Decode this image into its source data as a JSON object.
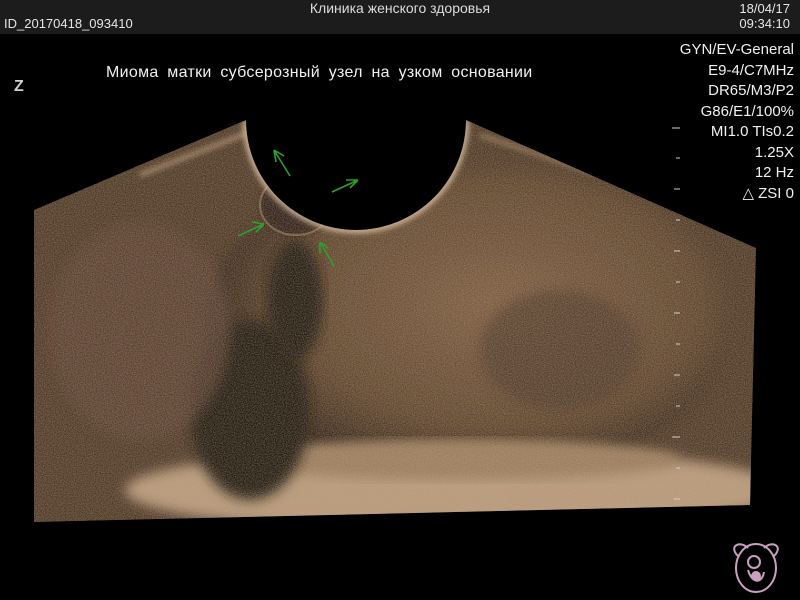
{
  "header": {
    "clinic": "Клиника женского здоровья",
    "scan_id": "ID_20170418_093410",
    "date": "18/04/17",
    "time": "09:34:10"
  },
  "caption": "Миома матки субсерозный узел на узком основании",
  "orientation_marker": "Z",
  "params": {
    "preset": "GYN/EV-General",
    "probe": "E9-4/C7MHz",
    "dr": "DR65/M3/P2",
    "gain": "G86/E1/100%",
    "mi_tis": "MI1.0 TIs0.2",
    "zoom": "1.25X",
    "frame_rate": "12 Hz",
    "zsi": "ZSI 0"
  },
  "colors": {
    "tissue": "#8a6a4a",
    "arrow": "#2ea02e",
    "logo": "#c8a0c0"
  },
  "icons": [
    "zsi-triangle-icon",
    "depth-scale-icon",
    "arrow-marker-icon",
    "clinic-logo-icon"
  ]
}
